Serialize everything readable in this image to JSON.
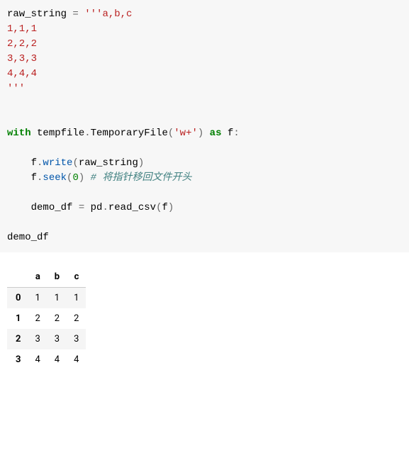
{
  "code": {
    "raw_var": "raw_string",
    "eq": " = ",
    "triple_open": "'''",
    "csv_header": "a,b,c",
    "csv_row1": "1,1,1",
    "csv_row2": "2,2,2",
    "csv_row3": "3,3,3",
    "csv_row4": "4,4,4",
    "triple_close": "'''",
    "with_kw": "with",
    "space": " ",
    "tempfile": "tempfile",
    "dot": ".",
    "temporaryfile": "TemporaryFile",
    "lparen": "(",
    "mode_str": "'w+'",
    "rparen": ")",
    "as_kw": " as",
    "f_name": " f",
    "colon": ":",
    "indent": "    ",
    "write_obj": "f",
    "write_call": "write",
    "write_arg": "raw_string",
    "seek_obj": "f",
    "seek_call": "seek",
    "seek_arg": "0",
    "comment": "# 将指针移回文件开头",
    "demo_df": "demo_df",
    "eq2": " = ",
    "pd": "pd",
    "read_csv": "read_csv",
    "read_arg": "f",
    "last": "demo_df"
  },
  "dataframe": {
    "columns": [
      "a",
      "b",
      "c"
    ],
    "index": [
      "0",
      "1",
      "2",
      "3"
    ],
    "rows": [
      [
        "1",
        "1",
        "1"
      ],
      [
        "2",
        "2",
        "2"
      ],
      [
        "3",
        "3",
        "3"
      ],
      [
        "4",
        "4",
        "4"
      ]
    ]
  },
  "chart_data": {
    "type": "table",
    "columns": [
      "a",
      "b",
      "c"
    ],
    "index": [
      0,
      1,
      2,
      3
    ],
    "data": [
      [
        1,
        1,
        1
      ],
      [
        2,
        2,
        2
      ],
      [
        3,
        3,
        3
      ],
      [
        4,
        4,
        4
      ]
    ]
  }
}
